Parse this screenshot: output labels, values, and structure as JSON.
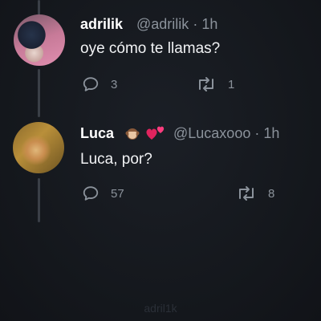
{
  "tweets": [
    {
      "name": "adrilik",
      "handle": "@adrilik",
      "time": "1h",
      "text": "oye cómo te llamas?",
      "replies": "3",
      "retweets": "1"
    },
    {
      "name": "Luca",
      "handle": "@Lucaxooo",
      "time": "1h",
      "text": "Luca, por?",
      "replies": "57",
      "retweets": "8",
      "name_emojis": [
        "monkey-emoji",
        "hearts-emoji"
      ]
    }
  ],
  "separator": "·",
  "watermark": "adril1k",
  "colors": {
    "background": "#15181d",
    "name": "#ffffff",
    "secondary": "#8b929b",
    "thread_line": "#3a3f47",
    "heart": "#e0245e"
  }
}
